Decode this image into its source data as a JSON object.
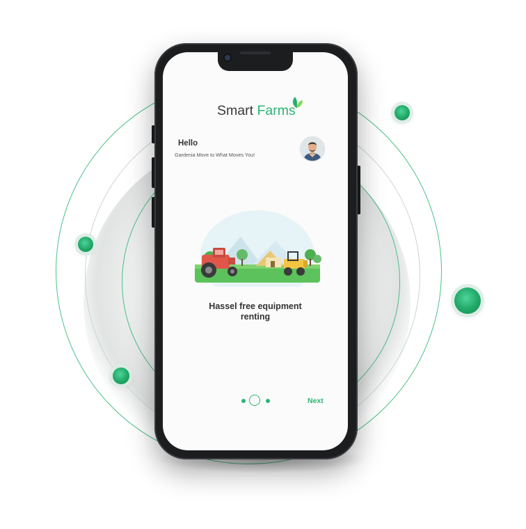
{
  "app": {
    "logo": {
      "word1": "Smart",
      "word2": "Farms",
      "leaf_icon": "leaf-icon"
    },
    "greeting": {
      "title": "Hello",
      "subtitle": "Gardenia Move to What Moves You!",
      "avatar": "user-avatar"
    },
    "onboarding": {
      "illustration": "farm-tractor-illustration",
      "caption_line1": "Hassel free equipment",
      "caption_line2": "renting",
      "page_index": 2,
      "page_count": 3,
      "next_label": "Next"
    }
  },
  "colors": {
    "accent": "#2bb673",
    "text": "#333333",
    "screen_bg": "#fbfbfb",
    "phone_frame": "#1c1d1f"
  }
}
